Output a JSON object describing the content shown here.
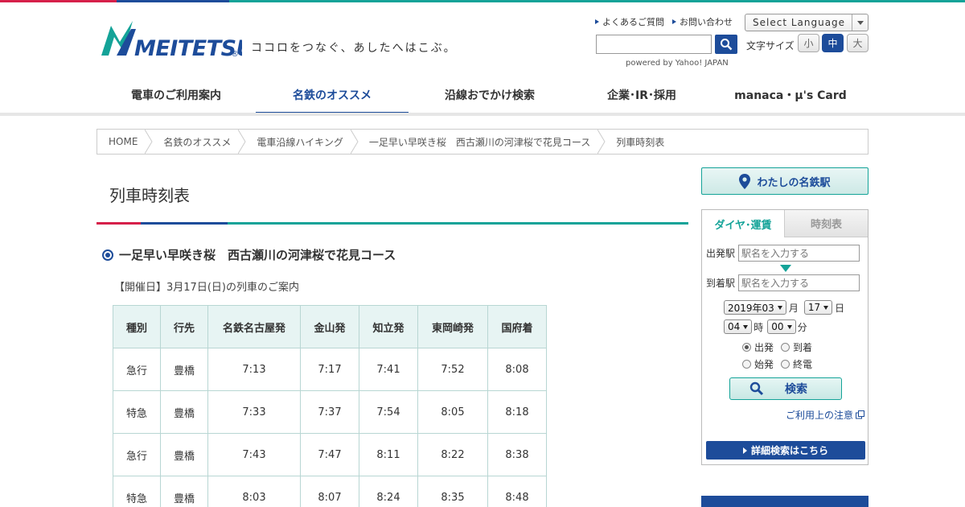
{
  "brand": {
    "logo_text": "MEITETSU",
    "registered": "®",
    "tagline": "ココロをつなぐ、あしたへはこぶ。",
    "colors": {
      "red": "#d6204a",
      "blue": "#1d4c9a",
      "teal": "#14a398"
    }
  },
  "header": {
    "links": [
      "よくあるご質問",
      "お問い合わせ"
    ],
    "language_select": "Select Language",
    "search": {
      "value": "",
      "button_icon": "search-icon"
    },
    "powered_by": "powered by Yahoo! JAPAN",
    "font_size": {
      "label": "文字サイズ",
      "options": [
        "小",
        "中",
        "大"
      ],
      "selected": "中"
    }
  },
  "nav": {
    "items": [
      "電車のご利用案内",
      "名鉄のオススメ",
      "沿線おでかけ検索",
      "企業･IR･採用",
      "manaca・μ's Card"
    ],
    "active": "名鉄のオススメ"
  },
  "breadcrumb": [
    "HOME",
    "名鉄のオススメ",
    "電車沿線ハイキング",
    "一足早い早咲き桜　西古瀬川の河津桜で花見コース",
    "列車時刻表"
  ],
  "main": {
    "title": "列車時刻表",
    "course": "一足早い早咲き桜　西古瀬川の河津桜で花見コース",
    "event_date": "【開催日】3月17日(日)の列車のご案内",
    "table": {
      "headers": [
        "種別",
        "行先",
        "名鉄名古屋発",
        "金山発",
        "知立発",
        "東岡崎発",
        "国府着"
      ],
      "rows": [
        [
          "急行",
          "豊橋",
          "7:13",
          "7:17",
          "7:41",
          "7:52",
          "8:08"
        ],
        [
          "特急",
          "豊橋",
          "7:33",
          "7:37",
          "7:54",
          "8:05",
          "8:18"
        ],
        [
          "急行",
          "豊橋",
          "7:43",
          "7:47",
          "8:11",
          "8:22",
          "8:38"
        ],
        [
          "特急",
          "豊橋",
          "8:03",
          "8:07",
          "8:24",
          "8:35",
          "8:48"
        ]
      ]
    }
  },
  "sidebar": {
    "my_meitetsu": "わたしの名鉄駅",
    "tabs": [
      "ダイヤ･運賃",
      "時刻表"
    ],
    "active_tab": "ダイヤ･運賃",
    "from_label": "出発駅",
    "to_label": "到着駅",
    "station_placeholder": "駅名を入力する",
    "date": {
      "year_month": "2019年03",
      "month_unit": "月",
      "day": "17",
      "day_unit": "日"
    },
    "time": {
      "hour": "04",
      "hour_unit": "時",
      "minute": "00",
      "minute_unit": "分"
    },
    "mode_options": [
      "出発",
      "到着",
      "始発",
      "終電"
    ],
    "mode_selected": "出発",
    "search_label": "検索",
    "notice": "ご利用上の注意",
    "detail_button": "詳細検索はこちら"
  }
}
